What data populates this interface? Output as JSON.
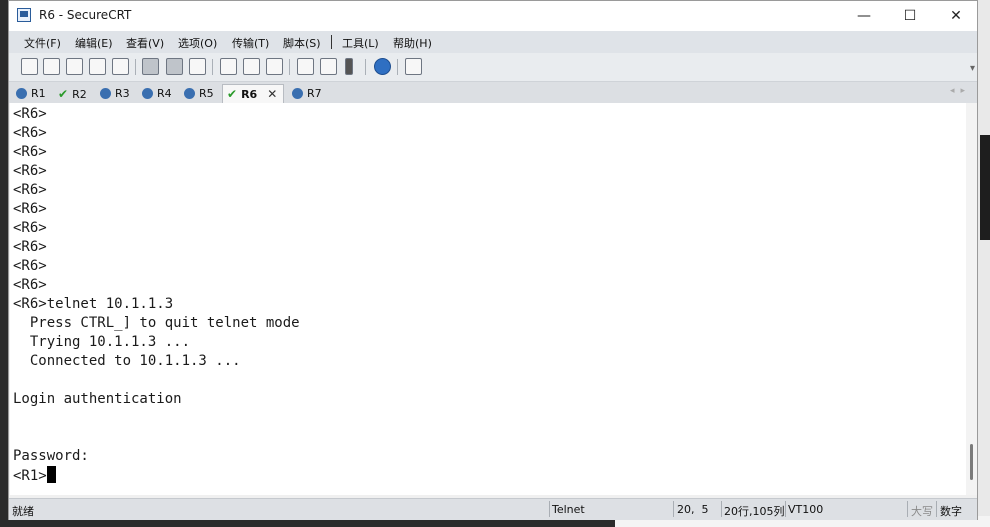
{
  "window": {
    "title": "R6 - SecureCRT"
  },
  "window_controls": {
    "minimize": "—",
    "maximize": "☐",
    "close": "✕"
  },
  "menu": [
    "文件(F)",
    "编辑(E)",
    "查看(V)",
    "选项(O)",
    "传输(T)",
    "脚本(S)",
    "工具(L)",
    "帮助(H)"
  ],
  "tabs": [
    {
      "label": "R1",
      "status": "info"
    },
    {
      "label": "R2",
      "status": "connected"
    },
    {
      "label": "R3",
      "status": "info"
    },
    {
      "label": "R4",
      "status": "info"
    },
    {
      "label": "R5",
      "status": "info"
    },
    {
      "label": "R6",
      "status": "connected",
      "active": true
    },
    {
      "label": "R7",
      "status": "info"
    }
  ],
  "terminal": {
    "lines": [
      "<R6>",
      "<R6>",
      "<R6>",
      "<R6>",
      "<R6>",
      "<R6>",
      "<R6>",
      "<R6>",
      "<R6>",
      "<R6>",
      "<R6>telnet 10.1.1.3",
      "  Press CTRL_] to quit telnet mode",
      "  Trying 10.1.1.3 ...",
      "  Connected to 10.1.1.3 ...",
      "",
      "Login authentication",
      "",
      "",
      "Password:",
      "<R1>"
    ]
  },
  "status": {
    "state": "就绪",
    "protocol": "Telnet",
    "position": "20,  5",
    "size": "20行,105列",
    "emulation": "VT100",
    "caps": "大写",
    "num": "数字"
  }
}
